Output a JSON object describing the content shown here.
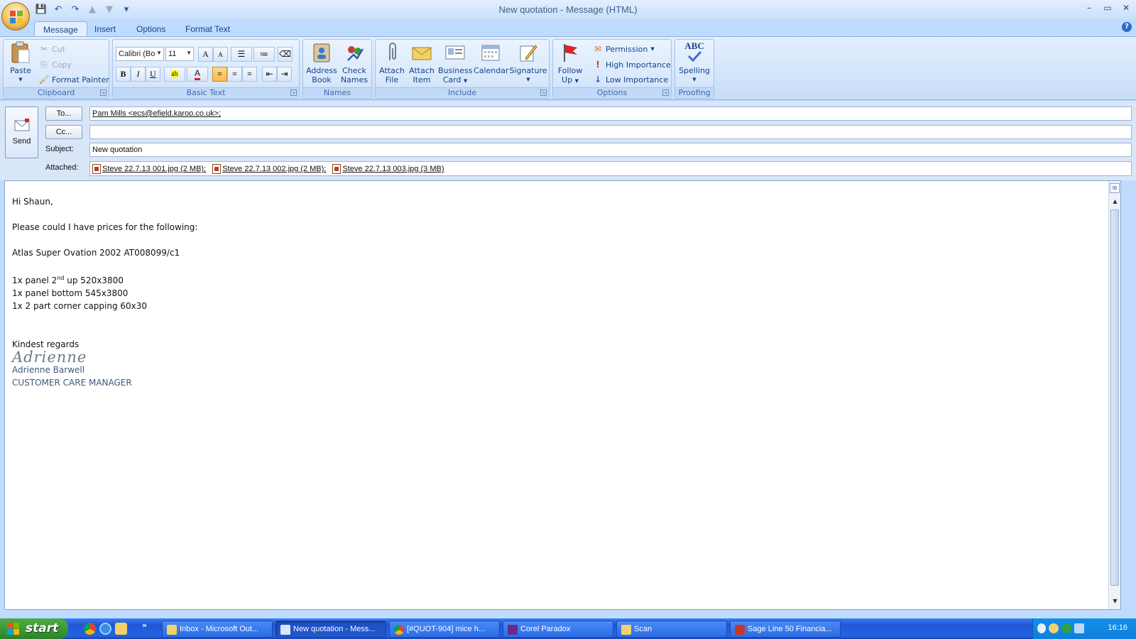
{
  "window": {
    "title": "New quotation - Message (HTML)",
    "min": "–",
    "restore": "▭",
    "close": "✕",
    "help": "?"
  },
  "qat": {
    "save": "💾",
    "undo": "↶",
    "redo": "↷",
    "up": "▲",
    "down": "▼",
    "customize": "▾"
  },
  "tabs": [
    {
      "label": "Message",
      "active": true
    },
    {
      "label": "Insert"
    },
    {
      "label": "Options"
    },
    {
      "label": "Format Text"
    }
  ],
  "ribbon": {
    "clipboard": {
      "label": "Clipboard",
      "paste": "Paste",
      "cut": "Cut",
      "copy": "Copy",
      "format_painter": "Format Painter"
    },
    "basic_text": {
      "label": "Basic Text",
      "font": "Calibri (Bo",
      "size": "11",
      "grow": "A",
      "shrink": "A",
      "bold": "B",
      "italic": "I",
      "underline": "U"
    },
    "names": {
      "label": "Names",
      "address_book_1": "Address",
      "address_book_2": "Book",
      "check_names_1": "Check",
      "check_names_2": "Names"
    },
    "include": {
      "label": "Include",
      "attach_file_1": "Attach",
      "attach_file_2": "File",
      "attach_item_1": "Attach",
      "attach_item_2": "Item",
      "business_card_1": "Business",
      "business_card_2": "Card",
      "calendar": "Calendar",
      "signature": "Signature"
    },
    "options": {
      "label": "Options",
      "follow_up_1": "Follow",
      "follow_up_2": "Up",
      "permission": "Permission",
      "high_importance": "High Importance",
      "low_importance": "Low Importance"
    },
    "proofing": {
      "label": "Proofing",
      "spelling": "Spelling",
      "abc": "ABC"
    }
  },
  "header": {
    "send": "Send",
    "to_button": "To...",
    "to_value": "Pam Mills <ecs@efield.karoo.co.uk>;",
    "cc_button": "Cc...",
    "cc_value": "",
    "subject_label": "Subject:",
    "subject_value": "New quotation",
    "attached_label": "Attached:",
    "attachments": [
      "Steve 22.7.13 001.jpg (2 MB);",
      "Steve 22.7.13 002.jpg (2 MB);",
      "Steve 22.7.13 003.jpg (3 MB)"
    ]
  },
  "body": {
    "greeting": "Hi Shaun,",
    "request": "Please could I have prices for the following:",
    "product": "Atlas Super Ovation 2002 AT008099/c1",
    "line1_pre": "1x panel 2",
    "line1_sup": "nd",
    "line1_post": " up 520x3800",
    "line2": "1x panel bottom 545x3800",
    "line3": "1x 2 part corner capping 60x30",
    "closing": "Kindest regards",
    "signature_script": "Adrienne",
    "sig_name": "Adrienne Barwell",
    "sig_title": "CUSTOMER CARE MANAGER"
  },
  "taskbar": {
    "start": "start",
    "more": "»",
    "tasks": [
      {
        "label": "Inbox - Microsoft Out..."
      },
      {
        "label": "New quotation - Mess...",
        "active": true
      },
      {
        "label": "[#QUOT-904] mice h..."
      },
      {
        "label": "Corel Paradox"
      },
      {
        "label": "Scan"
      },
      {
        "label": "Sage Line 50 Financia..."
      }
    ],
    "clock": "16:16"
  }
}
